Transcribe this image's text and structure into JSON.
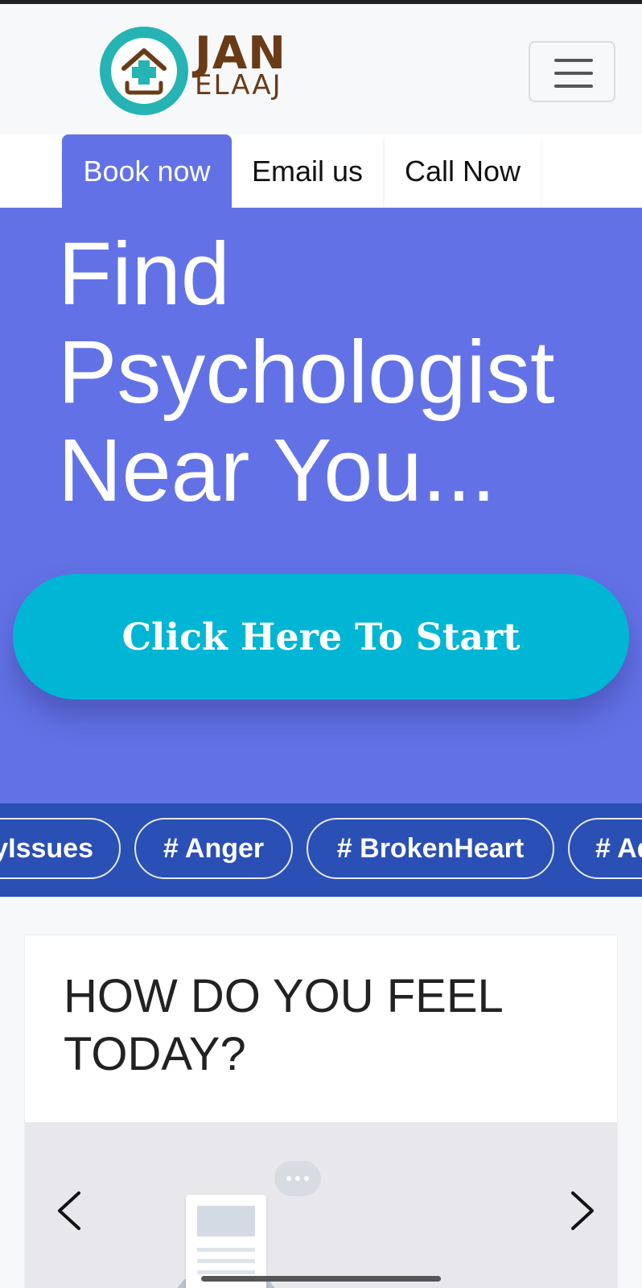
{
  "header": {
    "logo_line1": "JAN",
    "logo_line2": "ELAAJ"
  },
  "tabs": [
    {
      "label": "Book now"
    },
    {
      "label": "Email us"
    },
    {
      "label": "Call Now"
    }
  ],
  "hero": {
    "title": "Find Psychologist Near You...",
    "cta_label": "Click Here To Start"
  },
  "tags": [
    {
      "label": "# FamilyIssues"
    },
    {
      "label": "# Anger"
    },
    {
      "label": "# BrokenHeart"
    },
    {
      "label": "# Addiction"
    }
  ],
  "feel_section": {
    "title": "HOW DO YOU FEEL TODAY?"
  },
  "colors": {
    "primary": "#6272e6",
    "cta": "#00b6d4",
    "tags_bg": "#2a4fb5",
    "logo_teal": "#26b3b3",
    "logo_brown": "#6a3b17"
  },
  "icons": {
    "menu": "hamburger-icon",
    "carousel_prev": "chevron-left-icon",
    "carousel_next": "chevron-right-icon",
    "chat": "chat-bubble-icon"
  }
}
